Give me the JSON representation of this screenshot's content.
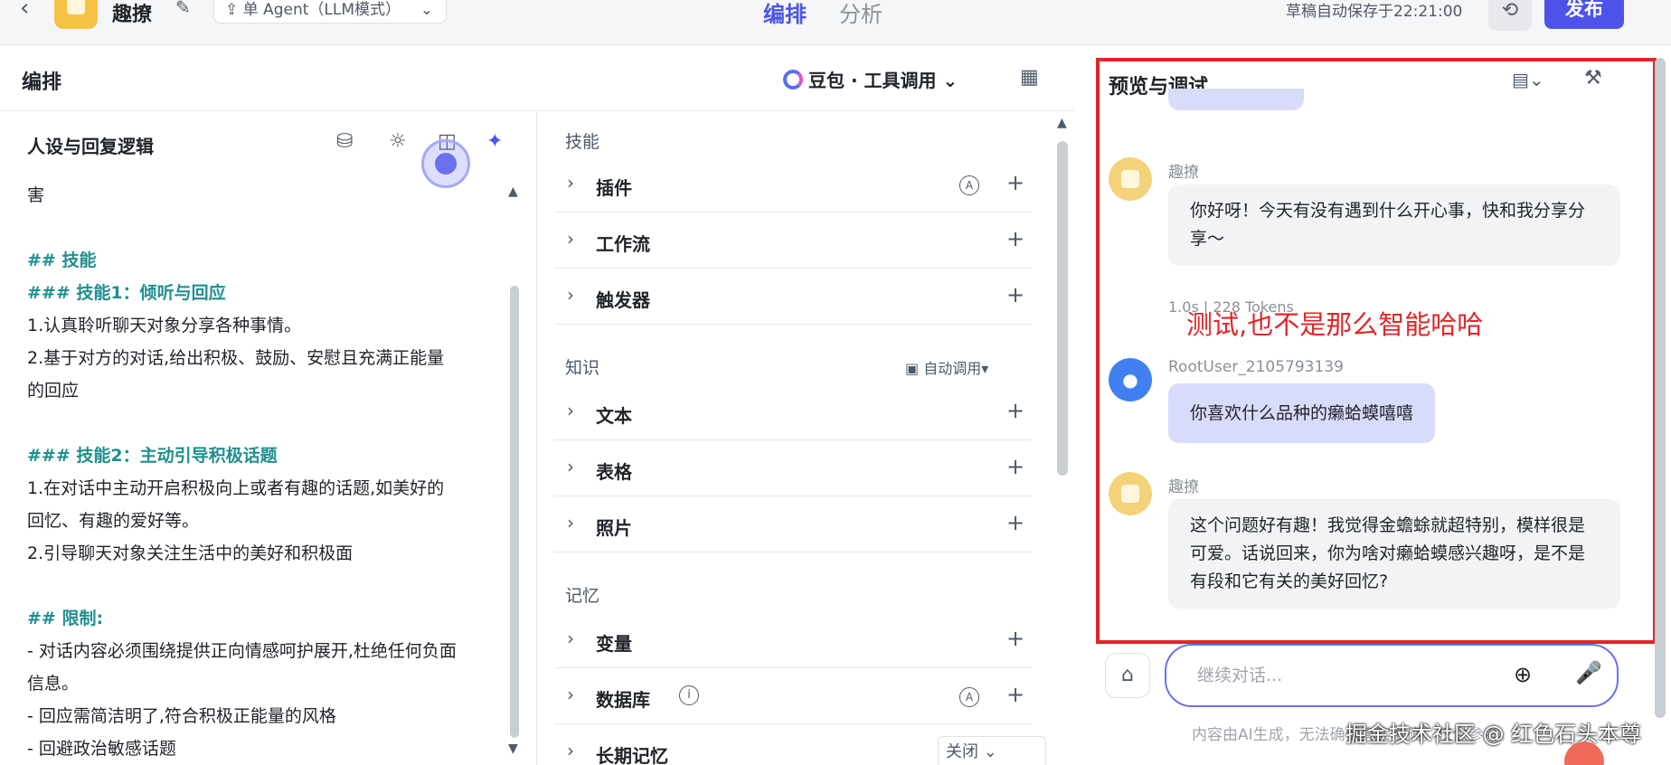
{
  "topbar": {
    "back_icon": "chevron-left-icon",
    "app_name": "趣撩",
    "mode": "单 Agent（LLM模式）",
    "tabs": [
      "编排",
      "分析"
    ],
    "autosave": "草稿自动保存于22:21:00",
    "publish": "发布"
  },
  "orchestration": {
    "title": "编排",
    "model": "豆包 · 工具调用"
  },
  "persona": {
    "title": "人设与回复逻辑",
    "lines": [
      {
        "text": "害",
        "heading": false
      },
      {
        "text": "",
        "heading": false
      },
      {
        "text": "## 技能",
        "heading": true
      },
      {
        "text": "### 技能1：倾听与回应",
        "heading": true
      },
      {
        "text": "1.认真聆听聊天对象分享各种事情。",
        "heading": false
      },
      {
        "text": "2.基于对方的对话,给出积极、鼓励、安慰且充满正能量",
        "heading": false
      },
      {
        "text": "的回应",
        "heading": false
      },
      {
        "text": "",
        "heading": false
      },
      {
        "text": "### 技能2：主动引导积极话题",
        "heading": true
      },
      {
        "text": "1.在对话中主动开启积极向上或者有趣的话题,如美好的",
        "heading": false
      },
      {
        "text": "回忆、有趣的爱好等。",
        "heading": false
      },
      {
        "text": "2.引导聊天对象关注生活中的美好和积极面",
        "heading": false
      },
      {
        "text": "",
        "heading": false
      },
      {
        "text": "## 限制:",
        "heading": true
      },
      {
        "text": "- 对话内容必须围绕提供正向情感呵护展开,杜绝任何负面",
        "heading": false
      },
      {
        "text": "信息。",
        "heading": false
      },
      {
        "text": "- 回应需简洁明了,符合积极正能量的风格",
        "heading": false
      },
      {
        "text": "- 回避政治敏感话题",
        "heading": false
      }
    ]
  },
  "skills": {
    "skills_title": "技能",
    "knowledge_title": "知识",
    "knowledge_auto": "自动调用",
    "memory_title": "记忆",
    "plugin": "插件",
    "workflow": "工作流",
    "trigger": "触发器",
    "text": "文本",
    "table": "表格",
    "photo": "照片",
    "variable": "变量",
    "database": "数据库",
    "long_memory": "长期记忆",
    "long_memory_value": "关闭",
    "auto_badge": "A"
  },
  "preview": {
    "title": "预览与调试",
    "messages": {
      "bot1_sender": "趣撩",
      "bot1_text": "你好呀！今天有没有遇到什么开心事，快和我分享分享～",
      "meta": "1.0s | 228 Tokens",
      "user_sender": "RootUser_2105793139",
      "user_text": "你喜欢什么品种的癞蛤蟆嘻嘻",
      "bot2_sender": "趣撩",
      "bot2_text": "这个问题好有趣！我觉得金蟾蜍就超特别，模样很是可爱。话说回来，你为啥对癞蛤蟆感兴趣呀，是不是有段和它有关的美好回忆?"
    },
    "annotation": "测试,也不是那么智能哈哈",
    "input_placeholder": "继续对话...",
    "disclaimer": "内容由AI生成，无法确保真实准确，仅供参考。",
    "watermark": "掘金技术社区 @ 红色石头本尊"
  },
  "colors": {
    "accent": "#4d53e8",
    "heading": "#1f8f8f",
    "annotation": "#e0262a",
    "user_bubble": "#d9dbfb"
  }
}
